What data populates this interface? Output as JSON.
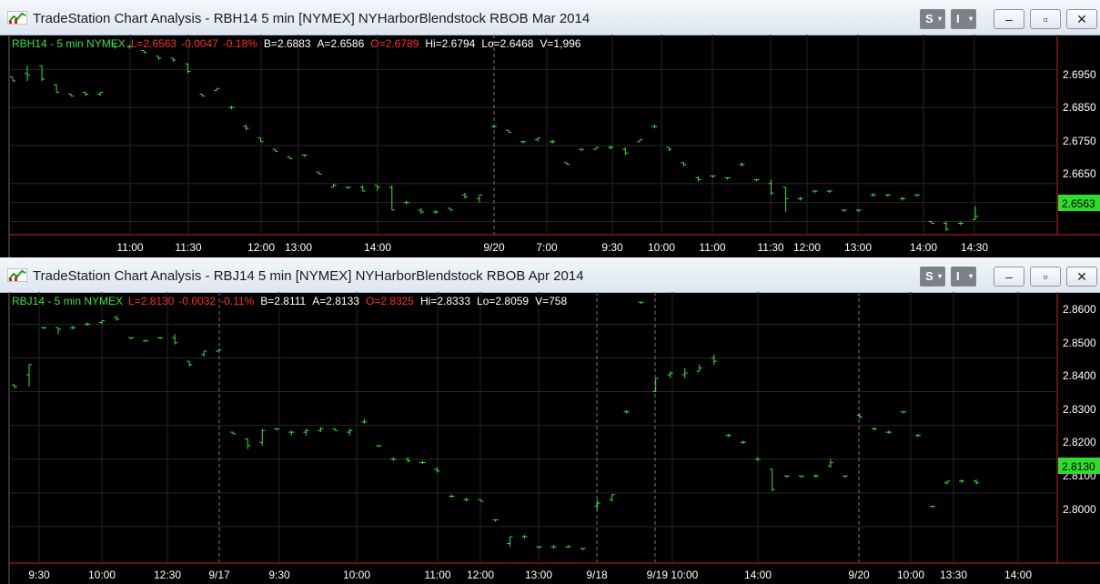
{
  "colors": {
    "bar": "#3fe03f",
    "sym": "#3fe03f",
    "red": "#ff2d2d",
    "white": "#ffffff",
    "last_bg": "#2ddc2d"
  },
  "windows": [
    {
      "title": "TradeStation Chart Analysis - RBH14 5 min [NYMEX] NYHarborBlendstock RBOB Mar 2014",
      "buttons": {
        "s": "S",
        "i": "I"
      },
      "status": {
        "symbol": "RBH14 - 5 min  NYMEX",
        "last": "L=2.6563",
        "chg": "-0.0047",
        "pct": "-0.18%",
        "bid": "B=2.6883",
        "ask": "A=2.6586",
        "open": "O=2.6789",
        "hi": "Hi=2.6794",
        "lo": "Lo=2.6468",
        "vol": "V=1,996"
      },
      "price_labels": [
        "2.6950",
        "2.6850",
        "2.6750",
        "2.6650"
      ],
      "last_price": "2.6563",
      "time_labels": [
        "11:00",
        "11:30",
        "12:00",
        "13:00",
        "14:00",
        "9/20",
        "7:00",
        "9:30",
        "10:00",
        "11:00",
        "11:30",
        "12:00",
        "13:00",
        "14:00",
        "14:30"
      ],
      "chart_data": {
        "type": "bar",
        "ohlc": [
          [
            2.693,
            2.693,
            2.692,
            2.692
          ],
          [
            2.694,
            2.696,
            2.692,
            2.6935
          ],
          [
            2.696,
            2.696,
            2.692,
            2.6925
          ],
          [
            2.691,
            2.691,
            2.689,
            2.689
          ],
          [
            2.6885,
            2.6885,
            2.688,
            2.688
          ],
          [
            2.689,
            2.689,
            2.688,
            2.6885
          ],
          [
            2.6885,
            2.689,
            2.688,
            2.689
          ],
          [
            2.7015,
            2.7015,
            2.7005,
            2.701
          ],
          [
            2.701,
            2.7015,
            2.7005,
            2.701
          ],
          [
            2.7,
            2.7,
            2.6995,
            2.6995
          ],
          [
            2.6985,
            2.6985,
            2.6975,
            2.698
          ],
          [
            2.698,
            2.698,
            2.697,
            2.6975
          ],
          [
            2.6965,
            2.6965,
            2.694,
            2.6945
          ],
          [
            2.6885,
            2.6885,
            2.688,
            2.688
          ],
          [
            2.6895,
            2.69,
            2.6895,
            2.69
          ],
          [
            2.685,
            2.6855,
            2.6845,
            2.685
          ],
          [
            2.68,
            2.6805,
            2.679,
            2.6795
          ],
          [
            2.677,
            2.677,
            2.676,
            2.676
          ],
          [
            2.674,
            2.674,
            2.6735,
            2.6735
          ],
          [
            2.672,
            2.672,
            2.6715,
            2.6715
          ],
          [
            2.6725,
            2.6725,
            2.672,
            2.6725
          ],
          [
            2.668,
            2.668,
            2.6675,
            2.6675
          ],
          [
            2.664,
            2.665,
            2.664,
            2.6645
          ],
          [
            2.664,
            2.664,
            2.6635,
            2.664
          ],
          [
            2.664,
            2.6645,
            2.663,
            2.663
          ],
          [
            2.6645,
            2.6645,
            2.663,
            2.664
          ],
          [
            2.664,
            2.6645,
            2.658,
            2.658
          ],
          [
            2.66,
            2.6605,
            2.6595,
            2.66
          ],
          [
            2.658,
            2.6585,
            2.657,
            2.6575
          ],
          [
            2.6575,
            2.658,
            2.657,
            2.6575
          ],
          [
            2.6585,
            2.6585,
            2.658,
            2.658
          ],
          [
            2.662,
            2.6625,
            2.661,
            2.6615
          ],
          [
            2.661,
            2.662,
            2.66,
            2.662
          ],
          [
            2.68,
            2.68,
            2.6795,
            2.68
          ],
          [
            2.679,
            2.679,
            2.6785,
            2.6785
          ],
          [
            2.676,
            2.676,
            2.6755,
            2.676
          ],
          [
            2.6765,
            2.677,
            2.676,
            2.677
          ],
          [
            2.676,
            2.6765,
            2.6755,
            2.676
          ],
          [
            2.6705,
            2.6705,
            2.67,
            2.67
          ],
          [
            2.674,
            2.674,
            2.6735,
            2.674
          ],
          [
            2.674,
            2.6745,
            2.674,
            2.6745
          ],
          [
            2.6745,
            2.675,
            2.674,
            2.6745
          ],
          [
            2.674,
            2.6745,
            2.6725,
            2.673
          ],
          [
            2.676,
            2.6765,
            2.676,
            2.6765
          ],
          [
            2.68,
            2.6805,
            2.6795,
            2.68
          ],
          [
            2.6745,
            2.6745,
            2.6735,
            2.674
          ],
          [
            2.6705,
            2.6705,
            2.6695,
            2.67
          ],
          [
            2.6665,
            2.667,
            2.6655,
            2.666
          ],
          [
            2.667,
            2.667,
            2.6665,
            2.667
          ],
          [
            2.6665,
            2.6665,
            2.666,
            2.6665
          ],
          [
            2.67,
            2.6705,
            2.6695,
            2.67
          ],
          [
            2.666,
            2.666,
            2.6655,
            2.666
          ],
          [
            2.665,
            2.666,
            2.662,
            2.6625
          ],
          [
            2.664,
            2.664,
            2.6575,
            2.661
          ],
          [
            2.661,
            2.6615,
            2.6605,
            2.661
          ],
          [
            2.663,
            2.663,
            2.6625,
            2.663
          ],
          [
            2.663,
            2.663,
            2.6625,
            2.663
          ],
          [
            2.658,
            2.658,
            2.6575,
            2.658
          ],
          [
            2.658,
            2.658,
            2.6575,
            2.658
          ],
          [
            2.662,
            2.6625,
            2.6615,
            2.662
          ],
          [
            2.662,
            2.662,
            2.6615,
            2.662
          ],
          [
            2.661,
            2.6615,
            2.6605,
            2.661
          ],
          [
            2.662,
            2.662,
            2.6615,
            2.662
          ],
          [
            2.655,
            2.655,
            2.6545,
            2.6545
          ],
          [
            2.6545,
            2.655,
            2.6525,
            2.653
          ],
          [
            2.6545,
            2.655,
            2.654,
            2.6545
          ],
          [
            2.6555,
            2.659,
            2.6555,
            2.6563
          ]
        ],
        "ylim": [
          2.652,
          2.703
        ]
      }
    },
    {
      "title": "TradeStation Chart Analysis - RBJ14 5 min [NYMEX] NYHarborBlendstock RBOB Apr 2014",
      "buttons": {
        "s": "S",
        "i": "I"
      },
      "status": {
        "symbol": "RBJ14 - 5 min  NYMEX",
        "last": "L=2.8130",
        "chg": "-0.0032",
        "pct": "-0.11%",
        "bid": "B=2.8111",
        "ask": "A=2.8133",
        "open": "O=2.8325",
        "hi": "Hi=2.8333",
        "lo": "Lo=2.8059",
        "vol": "V=758"
      },
      "price_labels": [
        "2.8600",
        "2.8500",
        "2.8400",
        "2.8300",
        "2.8200",
        "2.8100",
        "2.8000"
      ],
      "last_price": "2.8130",
      "time_labels": [
        "9:30",
        "10:00",
        "12:30",
        "9/17",
        "9:30",
        "10:00",
        "11:00",
        "12:00",
        "13:00",
        "9/18",
        "9/19 10:00",
        "14:00",
        "9/20",
        "10:00",
        "13:30",
        "14:00"
      ],
      "chart_data": {
        "type": "bar",
        "ohlc": [
          [
            2.842,
            2.842,
            2.841,
            2.8415
          ],
          [
            2.845,
            2.848,
            2.8415,
            2.848
          ],
          [
            2.859,
            2.859,
            2.8585,
            2.859
          ],
          [
            2.859,
            2.859,
            2.857,
            2.8585
          ],
          [
            2.859,
            2.8595,
            2.8585,
            2.859
          ],
          [
            2.86,
            2.8605,
            2.8595,
            2.86
          ],
          [
            2.8605,
            2.861,
            2.86,
            2.861
          ],
          [
            2.862,
            2.8625,
            2.861,
            2.8615
          ],
          [
            2.856,
            2.856,
            2.8555,
            2.856
          ],
          [
            2.855,
            2.8555,
            2.855,
            2.855
          ],
          [
            2.856,
            2.856,
            2.8555,
            2.856
          ],
          [
            2.856,
            2.857,
            2.854,
            2.8545
          ],
          [
            2.849,
            2.849,
            2.8475,
            2.848
          ],
          [
            2.851,
            2.852,
            2.8505,
            2.852
          ],
          [
            2.852,
            2.8525,
            2.852,
            2.8525
          ],
          [
            2.828,
            2.828,
            2.8275,
            2.8275
          ],
          [
            2.826,
            2.826,
            2.823,
            2.824
          ],
          [
            2.825,
            2.829,
            2.824,
            2.8285
          ],
          [
            2.829,
            2.829,
            2.8285,
            2.829
          ],
          [
            2.828,
            2.8285,
            2.827,
            2.828
          ],
          [
            2.828,
            2.829,
            2.827,
            2.8285
          ],
          [
            2.8285,
            2.8295,
            2.828,
            2.829
          ],
          [
            2.829,
            2.829,
            2.8285,
            2.8285
          ],
          [
            2.828,
            2.829,
            2.827,
            2.8285
          ],
          [
            2.831,
            2.832,
            2.8305,
            2.831
          ],
          [
            2.824,
            2.824,
            2.8235,
            2.824
          ],
          [
            2.82,
            2.8205,
            2.8195,
            2.82
          ],
          [
            2.82,
            2.8205,
            2.819,
            2.8195
          ],
          [
            2.819,
            2.8195,
            2.8185,
            2.819
          ],
          [
            2.817,
            2.8175,
            2.816,
            2.8165
          ],
          [
            2.809,
            2.8095,
            2.8085,
            2.809
          ],
          [
            2.808,
            2.8085,
            2.8075,
            2.808
          ],
          [
            2.808,
            2.808,
            2.8075,
            2.8075
          ],
          [
            2.802,
            2.802,
            2.8015,
            2.802
          ],
          [
            2.795,
            2.797,
            2.794,
            2.797
          ],
          [
            2.797,
            2.7975,
            2.7965,
            2.797
          ],
          [
            2.794,
            2.794,
            2.7935,
            2.794
          ],
          [
            2.794,
            2.7945,
            2.7935,
            2.794
          ],
          [
            2.794,
            2.7945,
            2.794,
            2.794
          ],
          [
            2.7935,
            2.7935,
            2.793,
            2.7935
          ],
          [
            2.806,
            2.808,
            2.805,
            2.807
          ],
          [
            2.808,
            2.8095,
            2.8075,
            2.8095
          ],
          [
            2.834,
            2.8345,
            2.8335,
            2.834
          ],
          [
            2.8665,
            2.8665,
            2.866,
            2.8665
          ],
          [
            2.84,
            2.844,
            2.84,
            2.844
          ],
          [
            2.845,
            2.846,
            2.844,
            2.8455
          ],
          [
            2.845,
            2.847,
            2.844,
            2.8455
          ],
          [
            2.846,
            2.848,
            2.846,
            2.847
          ],
          [
            2.85,
            2.851,
            2.848,
            2.849
          ],
          [
            2.827,
            2.8275,
            2.8265,
            2.827
          ],
          [
            2.825,
            2.8255,
            2.8245,
            2.825
          ],
          [
            2.82,
            2.8205,
            2.8195,
            2.82
          ],
          [
            2.817,
            2.817,
            2.8105,
            2.811
          ],
          [
            2.815,
            2.815,
            2.8145,
            2.815
          ],
          [
            2.815,
            2.815,
            2.8145,
            2.815
          ],
          [
            2.815,
            2.8155,
            2.8145,
            2.815
          ],
          [
            2.818,
            2.82,
            2.8175,
            2.819
          ],
          [
            2.815,
            2.815,
            2.8145,
            2.815
          ],
          [
            2.833,
            2.8335,
            2.832,
            2.8325
          ],
          [
            2.829,
            2.8295,
            2.8285,
            2.829
          ],
          [
            2.828,
            2.8285,
            2.8275,
            2.828
          ],
          [
            2.834,
            2.834,
            2.8335,
            2.834
          ],
          [
            2.827,
            2.8275,
            2.8265,
            2.827
          ],
          [
            2.806,
            2.806,
            2.8055,
            2.806
          ],
          [
            2.813,
            2.8135,
            2.8125,
            2.8135
          ],
          [
            2.8135,
            2.814,
            2.813,
            2.8135
          ],
          [
            2.8135,
            2.814,
            2.8125,
            2.813
          ]
        ],
        "ylim": [
          2.79,
          2.869
        ]
      }
    }
  ]
}
